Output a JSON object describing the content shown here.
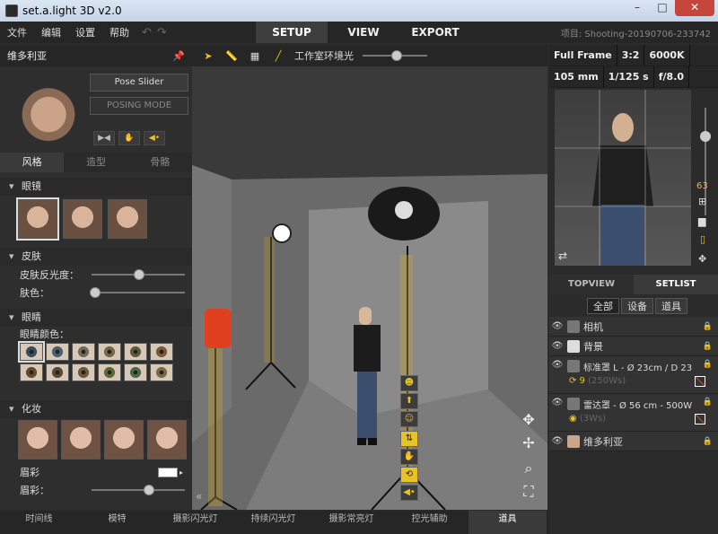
{
  "window": {
    "title": "set.a.light 3D v2.0"
  },
  "menu": {
    "items": [
      "文件",
      "编辑",
      "设置",
      "帮助"
    ]
  },
  "tabs": {
    "setup": "SETUP",
    "view": "VIEW",
    "export": "EXPORT"
  },
  "project": "项目: Shooting-20190706-233742",
  "left": {
    "title": "维多利亚",
    "pose_slider": "Pose Slider",
    "posing_mode": "POSING MODE",
    "subtabs": [
      "风格",
      "造型",
      "骨骼"
    ],
    "glasses": "眼镜",
    "skin": "皮肤",
    "skin_gloss": "皮肤反光度：",
    "skin_gloss_value": 0.5,
    "skin_color": "肤色：",
    "skin_color_value": 0.0,
    "eyes": "眼睛",
    "eye_color": "眼睛颜色：",
    "eye_colors": [
      "#3a4e63",
      "#4f6070",
      "#6d6a5e",
      "#76684a",
      "#5b5a3c",
      "#7a5a3a",
      "#6a4a2e",
      "#5b4b36",
      "#6c5a3e",
      "#5a6a3e",
      "#4b6a4b",
      "#7a6a4a"
    ],
    "makeup": "化妆",
    "eyebrow_color": "眉彩",
    "eyebrow": "眉彩：",
    "eyebrow_value": 0.62
  },
  "viewport": {
    "ambient_label": "工作室环境光",
    "ambient_value": 0.58
  },
  "camera": {
    "sensor": "Full Frame",
    "ratio": "3:2",
    "kelvin": "6000K",
    "focal": "105 mm",
    "shutter": "1/125 s",
    "aperture": "f/8.0",
    "zoom_value": "63"
  },
  "right": {
    "topview": "TOPVIEW",
    "setlist": "SETLIST",
    "filters": [
      "全部",
      "设备",
      "道具"
    ],
    "items": [
      {
        "label": "相机"
      },
      {
        "label": "背景"
      },
      {
        "label": "标准罩 L - Ø 23cm / D 23",
        "sub": "(250Ws)"
      },
      {
        "label": "雷达罩 - Ø 56 cm - 500W",
        "sub": "(3Ws)"
      },
      {
        "label": "维多利亚"
      }
    ]
  },
  "bottom": {
    "tabs": [
      "时间线",
      "模特",
      "摄影闪光灯",
      "持续闪光灯",
      "摄影常亮灯",
      "控光辅助",
      "道具"
    ]
  }
}
